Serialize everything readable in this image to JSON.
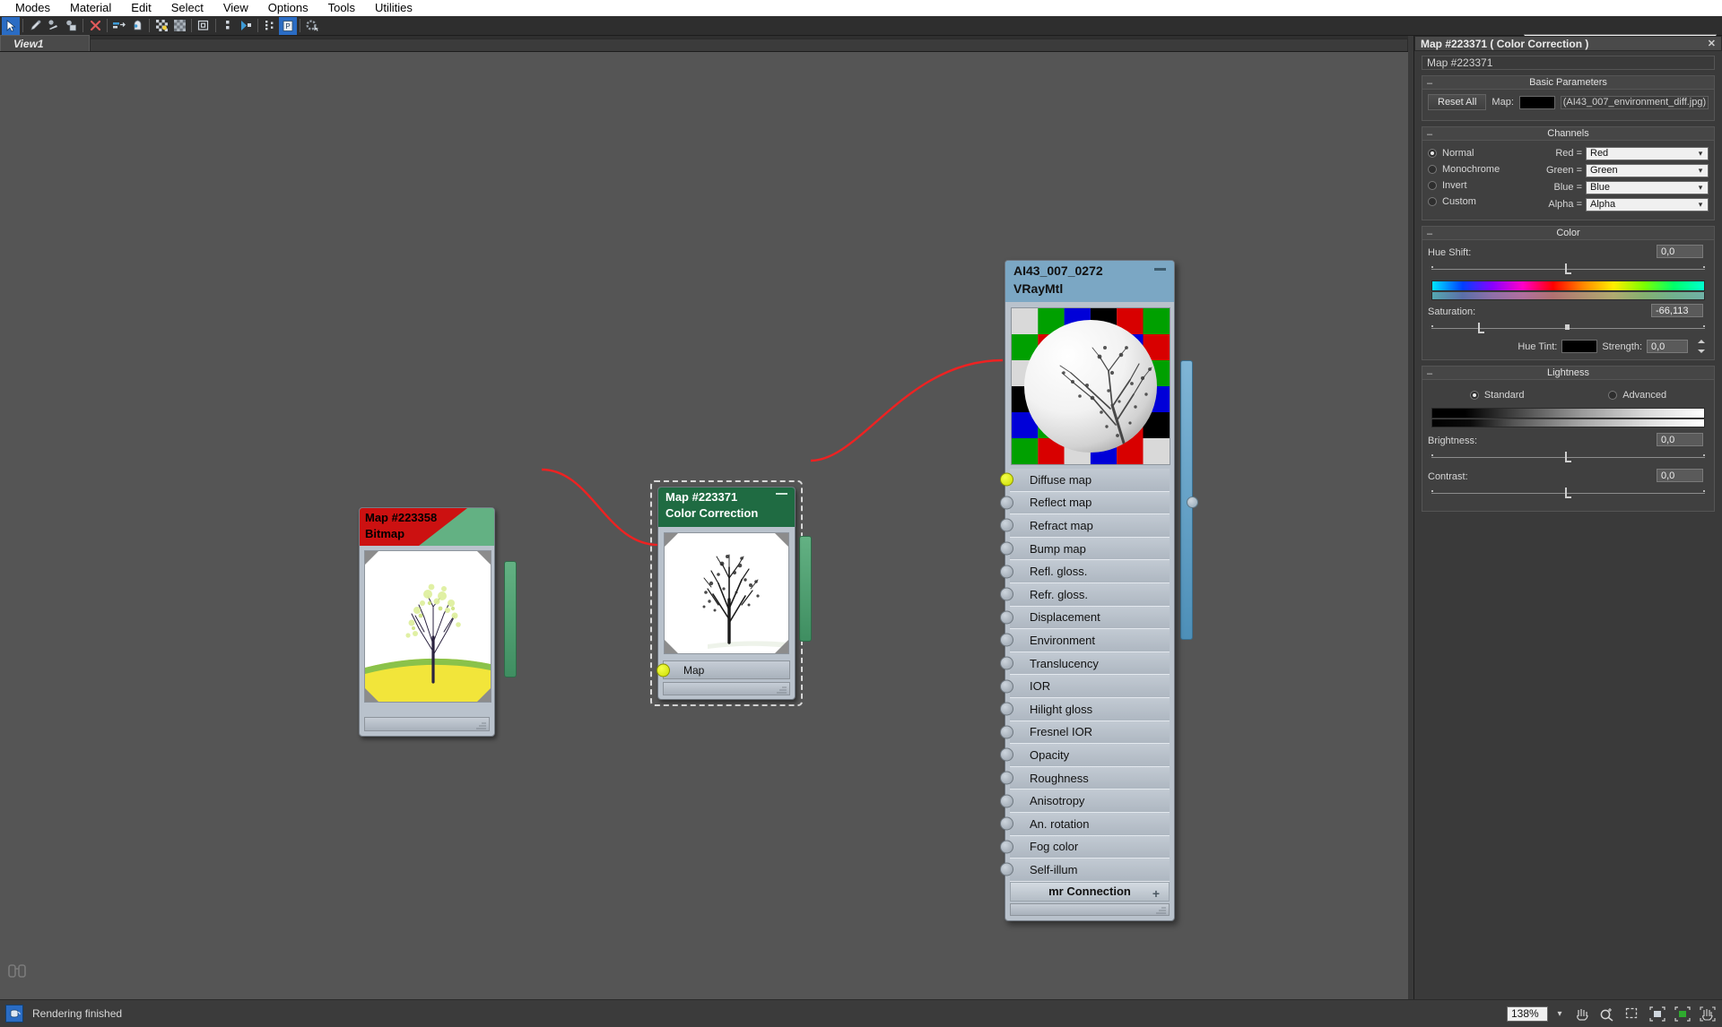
{
  "menubar": {
    "items": [
      {
        "label": "Modes",
        "name": "menu-modes"
      },
      {
        "label": "Material",
        "name": "menu-material"
      },
      {
        "label": "Edit",
        "name": "menu-edit"
      },
      {
        "label": "Select",
        "name": "menu-select"
      },
      {
        "label": "View",
        "name": "menu-view"
      },
      {
        "label": "Options",
        "name": "menu-options"
      },
      {
        "label": "Tools",
        "name": "menu-tools"
      },
      {
        "label": "Utilities",
        "name": "menu-utilities"
      }
    ]
  },
  "toolbar": {
    "icons": [
      "select-arrow-icon",
      "picker-eyedropper-icon",
      "assign-material-icon",
      "show-shaded-material-icon",
      "delete-x-icon",
      "move-children-icon",
      "update-material-icon",
      "background-checker-icon",
      "show-map-icon",
      "show-end-result-icon",
      "layout-children-icon",
      "material-id-channel-icon",
      "select-by-material-icon",
      "options-gear-icon"
    ],
    "selected_index": 0,
    "view_select_value": "View1",
    "view_select_arrow": "chevron-down-icon"
  },
  "tabstrip": {
    "tabs": [
      {
        "label": "View1",
        "active": true
      }
    ]
  },
  "canvas": {
    "background_color": "#555555",
    "binoculars_icon": "binoculars-icon",
    "nodes": {
      "bitmap": {
        "title": "Map #223358",
        "subtitle": "Bitmap",
        "thumbnail_alt": "tree-on-yellow-field-thumbnail",
        "header_color_primary": "#cc1111",
        "header_color_secondary": "#63b183"
      },
      "color_correction": {
        "title": "Map #223371",
        "subtitle": "Color Correction",
        "collapse_icon": "minimize-icon",
        "input_slot_label": "Map",
        "thumbnail_alt": "desaturated-tree-thumbnail",
        "header_color": "#1f6b42",
        "selected": true
      },
      "vraymtl": {
        "title": "AI43_007_0272",
        "subtitle": "VRayMtl",
        "collapse_icon": "minimize-icon",
        "header_color": "#7ba7c4",
        "thumbnail_alt": "sphere-preview-on-checker-background",
        "slots": [
          {
            "label": "Diffuse map",
            "connected": true
          },
          {
            "label": "Reflect map",
            "connected": false
          },
          {
            "label": "Refract map",
            "connected": false
          },
          {
            "label": "Bump map",
            "connected": false
          },
          {
            "label": "Refl. gloss.",
            "connected": false
          },
          {
            "label": "Refr. gloss.",
            "connected": false
          },
          {
            "label": "Displacement",
            "connected": false
          },
          {
            "label": "Environment",
            "connected": false
          },
          {
            "label": "Translucency",
            "connected": false
          },
          {
            "label": "IOR",
            "connected": false
          },
          {
            "label": "Hilight gloss",
            "connected": false
          },
          {
            "label": "Fresnel IOR",
            "connected": false
          },
          {
            "label": "Opacity",
            "connected": false
          },
          {
            "label": "Roughness",
            "connected": false
          },
          {
            "label": "Anisotropy",
            "connected": false
          },
          {
            "label": "An. rotation",
            "connected": false
          },
          {
            "label": "Fog color",
            "connected": false
          },
          {
            "label": "Self-illum",
            "connected": false
          }
        ],
        "mr_connection_label": "mr Connection",
        "mr_connection_expand_icon": "plus-icon"
      }
    },
    "wire_color": "#ee2222"
  },
  "panel": {
    "header_title": "Map #223371  ( Color Correction )",
    "close_icon": "close-icon",
    "name_field_value": "Map #223371",
    "rollouts": {
      "basic_parameters": {
        "title": "Basic Parameters",
        "collapse_icon": "minus-icon",
        "reset_all_label": "Reset All",
        "map_label": "Map:",
        "map_color": "#000000",
        "map_filename": "(AI43_007_environment_diff.jpg)"
      },
      "channels": {
        "title": "Channels",
        "collapse_icon": "minus-icon",
        "modes": [
          {
            "label": "Normal",
            "selected": true
          },
          {
            "label": "Monochrome",
            "selected": false
          },
          {
            "label": "Invert",
            "selected": false
          },
          {
            "label": "Custom",
            "selected": false
          }
        ],
        "assignments": [
          {
            "label": "Red =",
            "value": "Red"
          },
          {
            "label": "Green =",
            "value": "Green"
          },
          {
            "label": "Blue =",
            "value": "Blue"
          },
          {
            "label": "Alpha =",
            "value": "Alpha"
          }
        ]
      },
      "color": {
        "title": "Color",
        "collapse_icon": "minus-icon",
        "hue_shift_label": "Hue Shift:",
        "hue_shift_value": "0,0",
        "saturation_label": "Saturation:",
        "saturation_value": "-66,113",
        "hue_tint_label": "Hue Tint:",
        "hue_tint_color": "#000000",
        "strength_label": "Strength:",
        "strength_value": "0,0"
      },
      "lightness": {
        "title": "Lightness",
        "collapse_icon": "minus-icon",
        "standard_label": "Standard",
        "advanced_label": "Advanced",
        "mode_selected": "Standard",
        "brightness_label": "Brightness:",
        "brightness_value": "0,0",
        "contrast_label": "Contrast:",
        "contrast_value": "0,0"
      }
    }
  },
  "statusbar": {
    "icon": "render-teapot-icon",
    "message": "Rendering finished",
    "zoom_value": "138%",
    "zoom_arrow_icon": "chevron-down-icon",
    "nav_icons": [
      "pan-hand-icon",
      "zoom-magnifier-icon",
      "zoom-region-icon",
      "zoom-extents-icon",
      "zoom-extents-selected-icon",
      "pan-all-icon"
    ]
  }
}
